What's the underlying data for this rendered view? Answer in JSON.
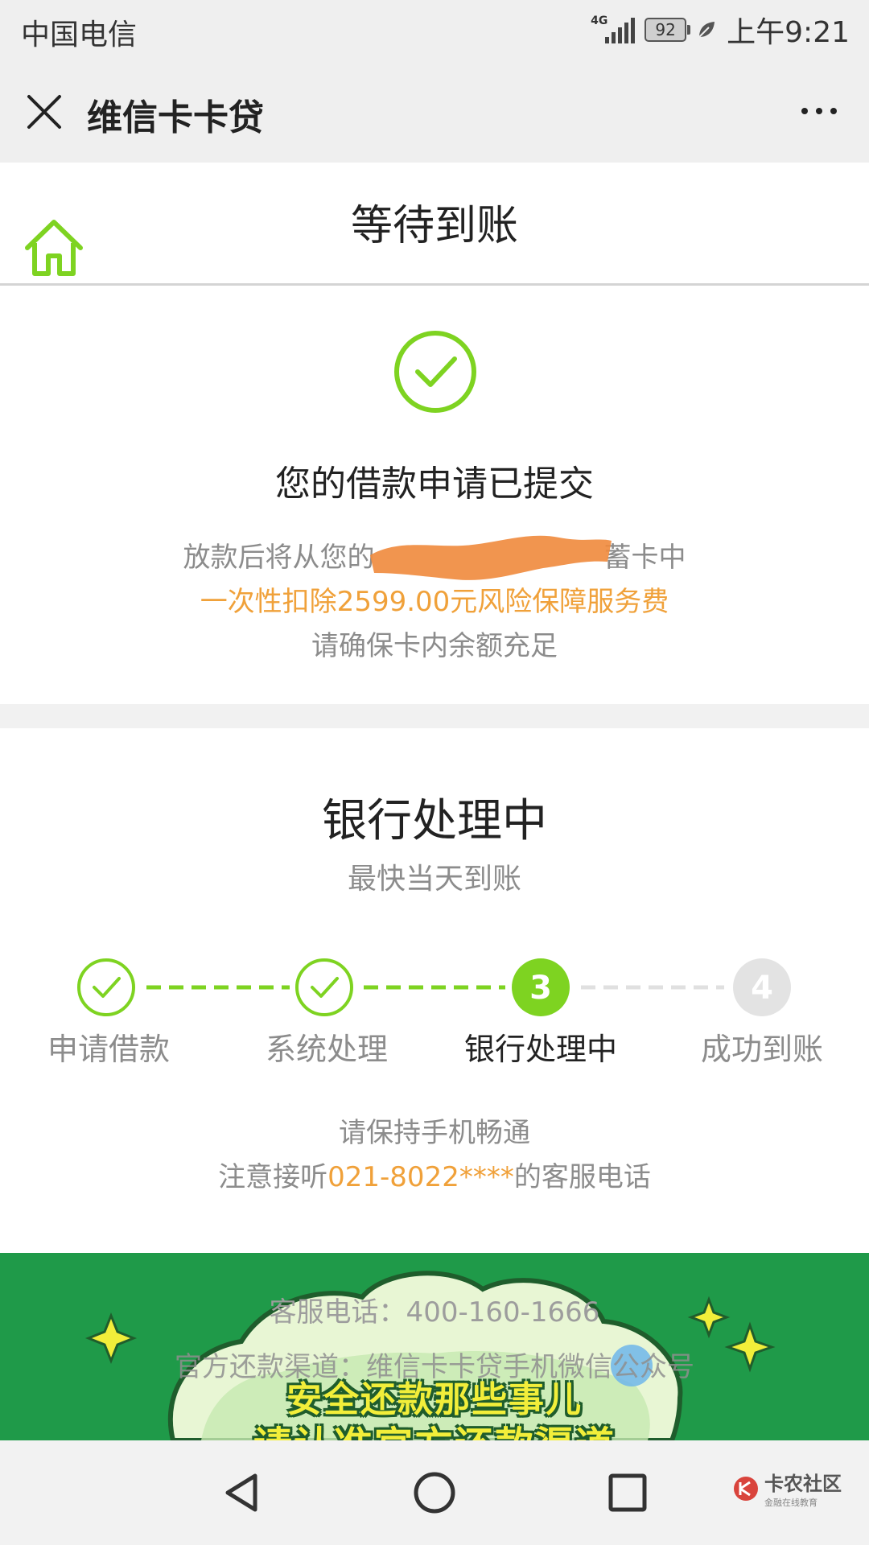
{
  "status_bar": {
    "carrier": "中国电信",
    "network": "4G",
    "battery": "92",
    "time": "上午9:21"
  },
  "nav": {
    "title": "维信卡卡贷"
  },
  "page": {
    "title": "等待到账"
  },
  "submission": {
    "title": "您的借款申请已提交",
    "note_line1_left": "放款后将从您的",
    "note_line1_right": "蓄卡中",
    "note_line2": "一次性扣除2599.00元风险保障服务费",
    "note_line3": "请确保卡内余额充足"
  },
  "processing": {
    "title": "银行处理中",
    "subtitle": "最快当天到账",
    "current_step": 3,
    "steps": [
      {
        "label": "申请借款",
        "state": "done"
      },
      {
        "label": "系统处理",
        "state": "done"
      },
      {
        "label": "银行处理中",
        "state": "current",
        "number": "3"
      },
      {
        "label": "成功到账",
        "state": "pending",
        "number": "4"
      }
    ],
    "hint_line1": "请保持手机畅通",
    "hint_line2_prefix": "注意接听",
    "hint_line2_phone": "021-8022****",
    "hint_line2_suffix": "的客服电话"
  },
  "banner": {
    "line1": "安全还款那些事儿",
    "line2": "请认准官方还款渠道",
    "phone_text": "客服电话：400-160-1666",
    "repay_text": "官方还款渠道：维信卡卡贷手机微信公众号"
  },
  "watermark": {
    "title": "卡农社区",
    "subtitle": "金融在线教育"
  },
  "colors": {
    "accent_green": "#7ed321",
    "accent_orange": "#f0a13a",
    "banner_green": "#1f9a49",
    "banner_text_yellow": "#f2ee3a"
  }
}
